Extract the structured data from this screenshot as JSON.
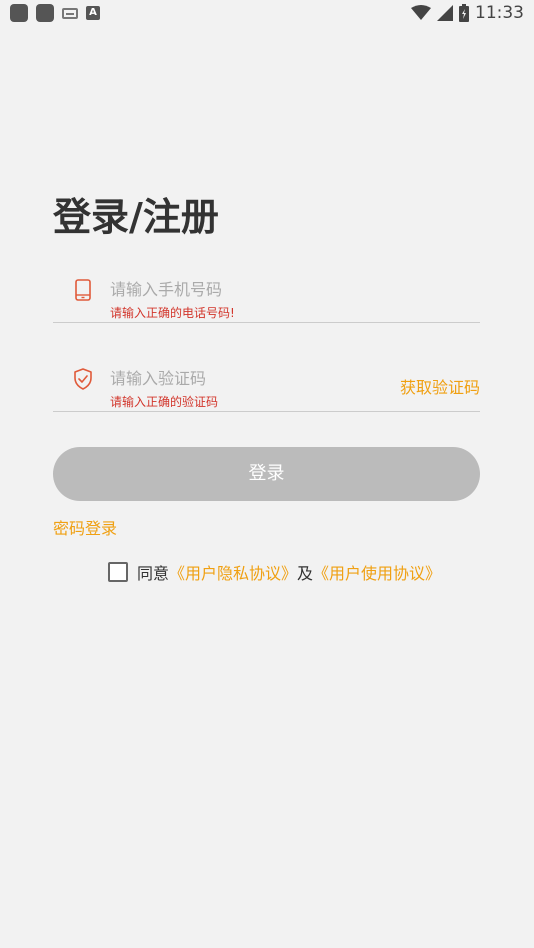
{
  "status_bar": {
    "time": "11:33",
    "ime_label": "A"
  },
  "page_title": "登录/注册",
  "phone_field": {
    "placeholder": "请输入手机号码",
    "value": "",
    "error": "请输入正确的电话号码!"
  },
  "code_field": {
    "placeholder": "请输入验证码",
    "value": "",
    "error": "请输入正确的验证码",
    "get_code_label": "获取验证码"
  },
  "login_button_label": "登录",
  "password_login_label": "密码登录",
  "agreement": {
    "checked": false,
    "prefix": "同意",
    "privacy_link": "《用户隐私协议》",
    "connector": "及",
    "usage_link": "《用户使用协议》"
  },
  "colors": {
    "accent": "#f0a012",
    "error": "#d2352b",
    "icon": "#e05a3a",
    "button_disabled": "#bbbbbb",
    "background": "#f2f2f2"
  },
  "icons": {
    "phone_field": "mobile-phone-icon",
    "code_field": "shield-check-icon"
  }
}
